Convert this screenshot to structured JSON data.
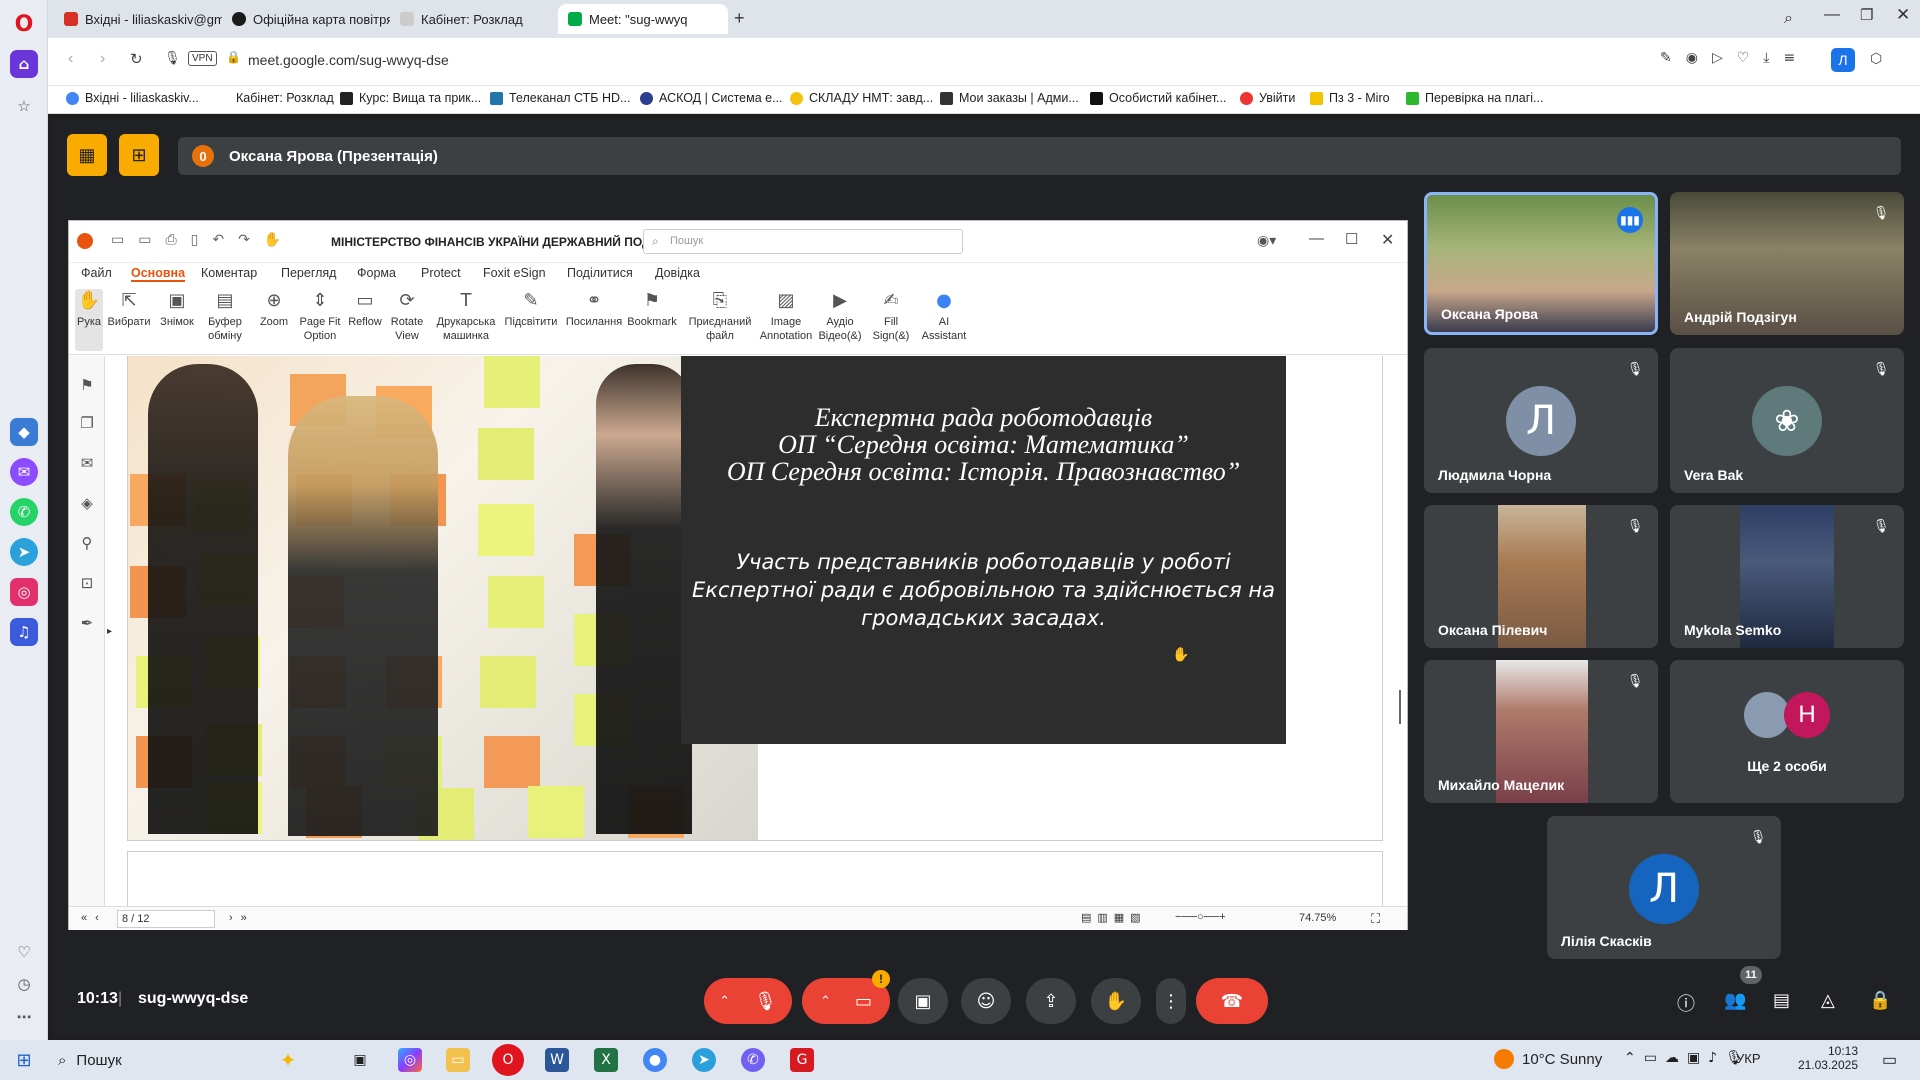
{
  "browser": {
    "tabs": [
      {
        "label": "Вхідні - liliaskaskiv@gmai",
        "color": "#d93025"
      },
      {
        "label": "Офіційна карта повітрян",
        "color": "#1a1a1a"
      },
      {
        "label": "Кабінет: Розклад",
        "color": "#cccccc"
      },
      {
        "label": "Meet: \"sug-wwyq",
        "color": "#00ac47"
      }
    ],
    "url": "meet.google.com/sug-wwyq-dse",
    "vpn_label": "VPN",
    "bookmarks": [
      "Вхідні - liliaskaskiv...",
      "Кабінет: Розклад",
      "Курс: Вища та прик...",
      "Телеканал СТБ HD...",
      "АСКОД | Система е...",
      "СКЛАДУ НМТ: завд...",
      "Мои заказы | Адми...",
      "Особистий кабінет...",
      "Увійти",
      "Пз 3 - Miro",
      "Перевірка на плагі..."
    ],
    "profile_letter": "Л"
  },
  "meet": {
    "presenter_count": "0",
    "presenter_label": "Оксана Ярова (Презентація)",
    "time": "10:13",
    "meeting_code": "sug-wwyq-dse",
    "participants_badge": "11",
    "warning_badge": "!"
  },
  "foxit": {
    "doc_title": "МІНІСТЕРСТВО ФІНАНСІВ УКРАЇНИ ДЕРЖАВНИЙ ПОДА...",
    "search_placeholder": "Пошук",
    "menu": [
      "Файл",
      "Основна",
      "Коментар",
      "Перегляд",
      "Форма",
      "Protect",
      "Foxit eSign",
      "Поділитися",
      "Довідка"
    ],
    "ribbon": [
      {
        "label": "Рука",
        "icon": "hand-icon"
      },
      {
        "label": "Вибрати",
        "icon": "cursor-icon"
      },
      {
        "label": "Знімок",
        "icon": "snapshot-icon"
      },
      {
        "label": "Буфер обміну",
        "icon": "clipboard-icon"
      },
      {
        "label": "Zoom",
        "icon": "zoom-icon"
      },
      {
        "label": "Page Fit Option",
        "icon": "page-fit-icon"
      },
      {
        "label": "Reflow",
        "icon": "reflow-icon"
      },
      {
        "label": "Rotate View",
        "icon": "rotate-icon"
      },
      {
        "label": "Друкарська машинка",
        "icon": "typewriter-icon"
      },
      {
        "label": "Підсвітити",
        "icon": "highlight-icon"
      },
      {
        "label": "Посилання",
        "icon": "link-icon"
      },
      {
        "label": "Bookmark",
        "icon": "bookmark-icon"
      },
      {
        "label": "Приєднаний файл",
        "icon": "attach-icon"
      },
      {
        "label": "Image Annotation",
        "icon": "image-icon"
      },
      {
        "label": "Аудіо Відео(&)",
        "icon": "audio-video-icon"
      },
      {
        "label": "Fill Sign(&)",
        "icon": "fill-sign-icon"
      },
      {
        "label": "AI Assistant",
        "icon": "ai-icon"
      }
    ],
    "page_indicator": "8 / 12",
    "zoom": "74.75%",
    "slide": {
      "title_lines": [
        "Експертна рада роботодавців",
        "ОП “Середня освіта: Математика”",
        "ОП Середня освіта: Історія. Правознавство”"
      ],
      "body": "Участь представників роботодавців у роботі Експертної ради є добровільною та здійснюється на громадських засадах."
    }
  },
  "participants": [
    {
      "name": "Оксана Ярова",
      "type": "video",
      "speaking": true
    },
    {
      "name": "Андрій Подзігун",
      "type": "video",
      "muted": true
    },
    {
      "name": "Людмила Чорна",
      "type": "avatar",
      "letter": "Л",
      "color": "#7f8fa6",
      "muted": true
    },
    {
      "name": "Vera Bak",
      "type": "avatar",
      "letter": "",
      "color": "#5f7a7a",
      "muted": true
    },
    {
      "name": "Оксана Пілевич",
      "type": "video",
      "muted": true
    },
    {
      "name": "Mykola Semko",
      "type": "video",
      "muted": true
    },
    {
      "name": "Михайло Мацелик",
      "type": "video",
      "muted": true
    },
    {
      "name": "Ще 2 особи",
      "type": "group",
      "letter": "H",
      "color": "#c2185b"
    },
    {
      "name": "Лілія Скаскiв",
      "type": "avatar",
      "letter": "Л",
      "color": "#1565c0",
      "muted": true
    }
  ],
  "taskbar": {
    "search_label": "Пошук",
    "weather": "10°C  Sunny",
    "lang": "УКР",
    "time": "10:13",
    "date": "21.03.2025"
  }
}
